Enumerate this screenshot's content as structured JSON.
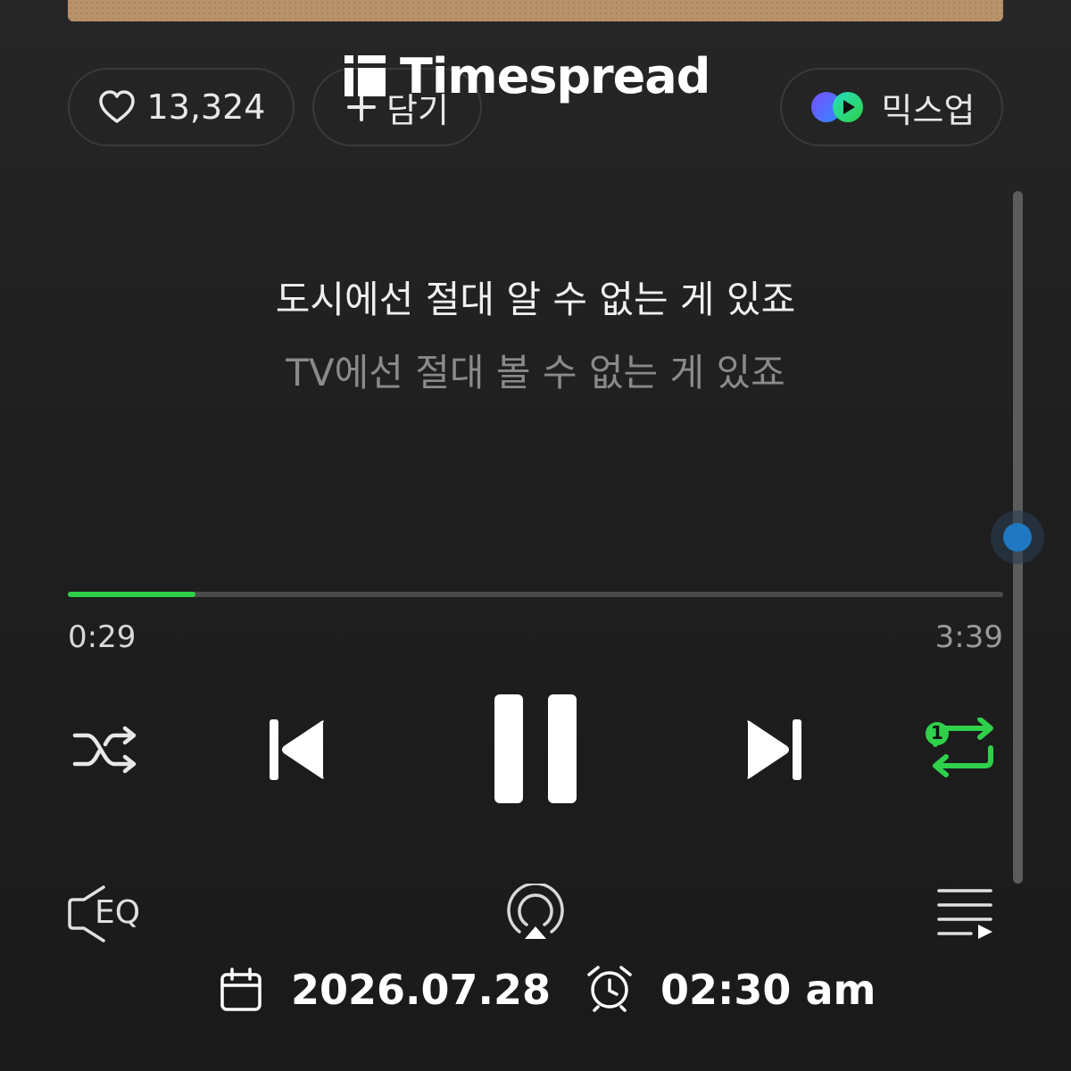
{
  "brand": {
    "name": "Timespread"
  },
  "actions": {
    "like_count": "13,324",
    "add_label": "담기",
    "mixup_label": "믹스업"
  },
  "lyrics": {
    "current": "도시에선 절대 알 수 없는 게 있죠",
    "next": "TV에선 절대 볼 수 없는 게 있죠"
  },
  "player": {
    "elapsed": "0:29",
    "total": "3:39",
    "progress_fraction": 0.1364,
    "repeat_badge": "1",
    "accent_color": "#2fd04a"
  },
  "tools": {
    "eq_label": "EQ"
  },
  "overlay": {
    "date": "2026.07.28",
    "time": "02:30 am"
  },
  "icons": {
    "like": "heart-icon",
    "add": "plus-icon",
    "mixup": "mixup-logo-icon",
    "shuffle": "shuffle-icon",
    "previous": "skip-previous-icon",
    "pause": "pause-icon",
    "next": "skip-next-icon",
    "repeat": "repeat-one-icon",
    "eq": "eq-speaker-icon",
    "airplay": "airplay-icon",
    "playlist": "playlist-icon",
    "calendar": "calendar-icon",
    "alarm": "alarm-clock-icon"
  }
}
